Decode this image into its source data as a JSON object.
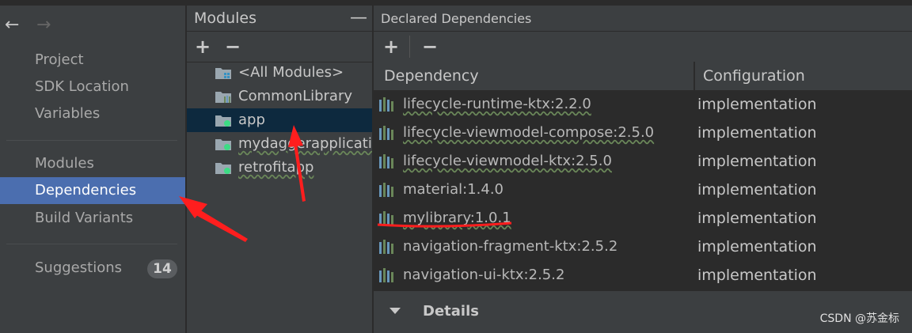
{
  "nav": {
    "back_glyph": "←",
    "forward_glyph": "→",
    "items": [
      {
        "label": "Project"
      },
      {
        "label": "SDK Location"
      },
      {
        "label": "Variables"
      },
      {
        "label": "Modules"
      },
      {
        "label": "Dependencies",
        "selected": true
      },
      {
        "label": "Build Variants"
      },
      {
        "label": "Suggestions",
        "badge": "14"
      }
    ]
  },
  "modules": {
    "title": "Modules",
    "collapse_glyph": "—",
    "add_glyph": "+",
    "remove_glyph": "−",
    "items": [
      {
        "label": "<All Modules>",
        "icon": "all-modules-icon"
      },
      {
        "label": "CommonLibrary",
        "icon": "library-module-icon"
      },
      {
        "label": "app",
        "icon": "app-module-icon",
        "selected": true
      },
      {
        "label": "mydaggerapplication",
        "icon": "app-module-icon"
      },
      {
        "label": "retrofitapp",
        "icon": "app-module-icon"
      }
    ]
  },
  "dependencies": {
    "title": "Declared Dependencies",
    "add_glyph": "+",
    "remove_glyph": "−",
    "columns": [
      "Dependency",
      "Configuration"
    ],
    "rows": [
      {
        "name": "lifecycle-runtime-ktx:2.2.0",
        "config": "implementation"
      },
      {
        "name": "lifecycle-viewmodel-compose:2.5.0",
        "config": "implementation"
      },
      {
        "name": "lifecycle-viewmodel-ktx:2.5.0",
        "config": "implementation"
      },
      {
        "name": "material:1.4.0",
        "config": "implementation"
      },
      {
        "name": "mylibrary:1.0.1",
        "config": "implementation"
      },
      {
        "name": "navigation-fragment-ktx:2.5.2",
        "config": "implementation"
      },
      {
        "name": "navigation-ui-ktx:2.5.2",
        "config": "implementation"
      }
    ],
    "details_label": "Details"
  },
  "watermark": "CSDN @苏金标",
  "colors": {
    "selection": "#4b6eaf",
    "module_selection": "#0d293e",
    "annotation_red": "#ff1e1e",
    "library_icon_green": "#6a8759",
    "library_icon_blue": "#6897bb"
  }
}
